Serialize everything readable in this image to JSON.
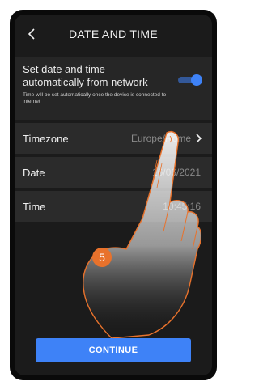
{
  "header": {
    "title": "DATE AND TIME",
    "back_icon": "chevron-left-icon"
  },
  "auto_sync": {
    "title": "Set date and time automatically from network",
    "description": "Time will be set automatically once the device is connected to internet",
    "enabled": true,
    "accent_color": "#3e82f7"
  },
  "settings": {
    "timezone": {
      "label": "Timezone",
      "value": "Europe/Rome"
    },
    "date": {
      "label": "Date",
      "value": "16/06/2021"
    },
    "time": {
      "label": "Time",
      "value": "10:45:16"
    }
  },
  "step_badge": "5",
  "continue_label": "CONTINUE"
}
